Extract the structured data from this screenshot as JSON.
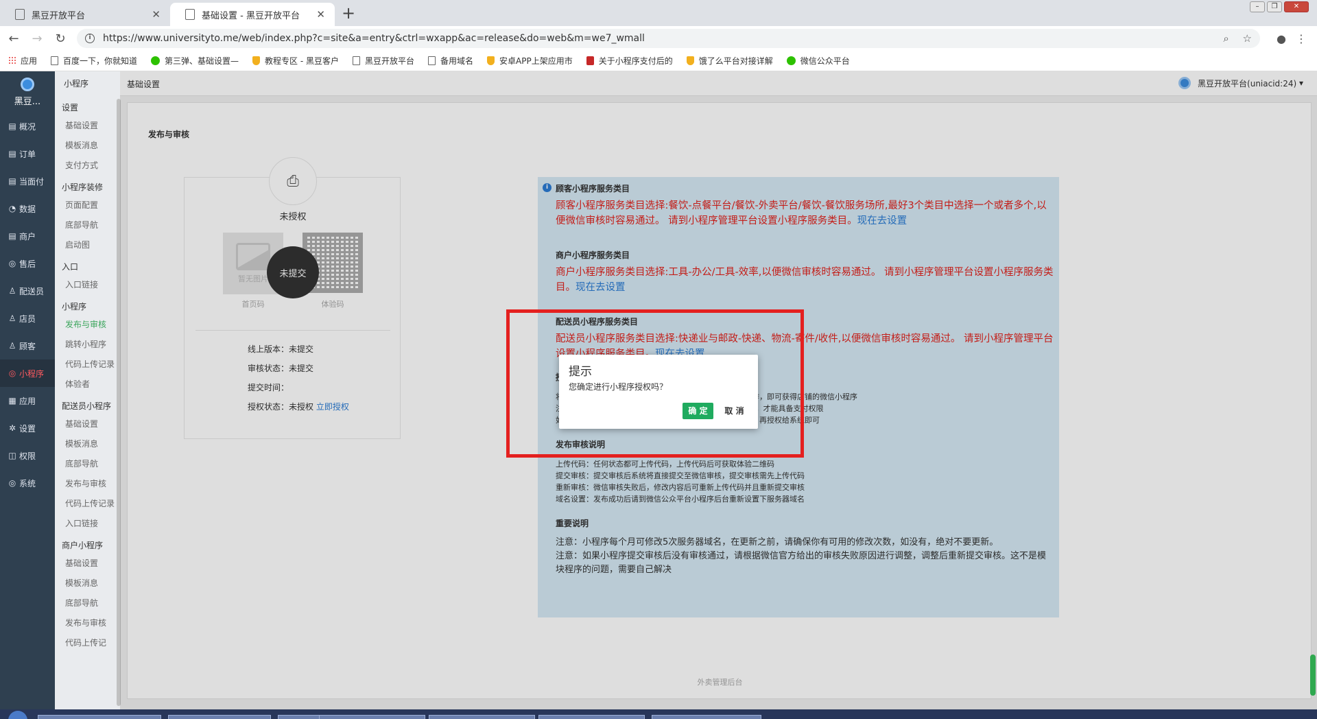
{
  "browser": {
    "tabs": [
      {
        "title": "黑豆开放平台",
        "active": false
      },
      {
        "title": "基础设置 - 黑豆开放平台",
        "active": true
      }
    ],
    "url": "https://www.universityto.me/web/index.php?c=site&a=entry&ctrl=wxapp&ac=release&do=web&m=we7_wmall",
    "bookmarks": [
      "应用",
      "百度一下，你就知道",
      "第三弹、基础设置—",
      "教程专区 - 黑豆客户",
      "黑豆开放平台",
      "备用域名",
      "安卓APP上架应用市",
      "关于小程序支付后的",
      "饿了么平台对接详解",
      "微信公众平台"
    ]
  },
  "app": {
    "logo_text": "黑豆...",
    "rail": [
      {
        "icon": "▤",
        "label": "概况"
      },
      {
        "icon": "▤",
        "label": "订单"
      },
      {
        "icon": "▤",
        "label": "当面付"
      },
      {
        "icon": "◔",
        "label": "数据"
      },
      {
        "icon": "▤",
        "label": "商户"
      },
      {
        "icon": "◎",
        "label": "售后"
      },
      {
        "icon": "♙",
        "label": "配送员"
      },
      {
        "icon": "♙",
        "label": "店员"
      },
      {
        "icon": "♙",
        "label": "顾客"
      },
      {
        "icon": "◎",
        "label": "小程序"
      },
      {
        "icon": "▦",
        "label": "应用"
      },
      {
        "icon": "✲",
        "label": "设置"
      },
      {
        "icon": "◫",
        "label": "权限"
      },
      {
        "icon": "◎",
        "label": "系统"
      }
    ],
    "sub_nav": {
      "header": "小程序",
      "g1": "设置",
      "g1_items": [
        "基础设置",
        "模板消息",
        "支付方式"
      ],
      "g2": "小程序装修",
      "g2_items": [
        "页面配置",
        "底部导航",
        "启动图"
      ],
      "g3": "入口",
      "g3_items": [
        "入口链接"
      ],
      "g4": "小程序",
      "g4_items": [
        "发布与审核",
        "跳转小程序",
        "代码上传记录",
        "体验者"
      ],
      "g5": "配送员小程序",
      "g5_items": [
        "基础设置",
        "模板消息",
        "底部导航",
        "发布与审核",
        "代码上传记录",
        "入口链接"
      ],
      "g6": "商户小程序",
      "g6_items": [
        "基础设置",
        "模板消息",
        "底部导航",
        "发布与审核",
        "代码上传记"
      ]
    },
    "breadcrumb": "基础设置",
    "account": "黑豆开放平台(uniacid:24)",
    "panel_title": "发布与审核",
    "card": {
      "auth_status": "未授权",
      "placeholder_text": "暂无图片",
      "home_code_label": "首页码",
      "exp_code_label": "体验码",
      "status_circle": "未提交",
      "online_version": "线上版本：未提交",
      "review_status": "审核状态：未提交",
      "submit_time": "提交时间：",
      "auth_status_label": "授权状态：未授权",
      "auth_link": "立即授权"
    },
    "notice": {
      "customer_title": "顾客小程序服务类目",
      "customer_text": "顾客小程序服务类目选择:餐饮-点餐平台/餐饮-外卖平台/餐饮-餐饮服务场所,最好3个类目中选择一个或者多个,以便微信审核时容易通过。 请到小程序管理平台设置小程序服务类目。",
      "customer_link": "现在去设置",
      "merchant_title": "商户小程序服务类目",
      "merchant_text": "商户小程序服务类目选择:工具-办公/工具-效率,以便微信审核时容易通过。 请到小程序管理平台设置小程序服务类目。",
      "merchant_link": "现在去设置",
      "deliver_title": "配送员小程序服务类目",
      "deliver_text": "配送员小程序服务类目选择:快递业与邮政-快递、物流-寄件/收件,以便微信审核时容易通过。 请到小程序管理平台设置小程序服务类目。",
      "deliver_link": "现在去设置",
      "auth_title": "授权说明",
      "auth_lines": [
        "将小程序授权给本平台，并提交到微信；你不需要做复杂操作，即可获得店铺的微信小程序",
        "注意：你的小程序的主体必须是「企业」，并开通了微信支付，才能具备支付权限",
        "如果你还没有注册微信小程序，点击此处注册；注册成功后，再授权给系统即可"
      ],
      "release_title": "发布审核说明",
      "release_lines": [
        "上传代码：任何状态都可上传代码，上传代码后可获取体验二维码",
        "提交审核：提交审核后系统将直接提交至微信审核，提交审核需先上传代码",
        "重新审核：微信审核失败后，修改内容后可重新上传代码并且重新提交审核",
        "域名设置：发布成功后请到微信公众平台小程序后台重新设置下服务器域名"
      ],
      "important_title": "重要说明",
      "important_lines": [
        "注意：小程序每个月可修改5次服务器域名，在更新之前，请确保你有可用的修改次数，如没有，绝对不要更新。",
        "注意：如果小程序提交审核后没有审核通过，请根据微信官方给出的审核失败原因进行调整，调整后重新提交审核。这不是模块程序的问题，需要自己解决"
      ]
    },
    "footer": "外卖管理后台"
  },
  "dialog": {
    "title": "提示",
    "message": "您确定进行小程序授权吗？",
    "ok": "确 定",
    "cancel": "取 消"
  },
  "colors": {
    "rail_bg": "#2f4050",
    "accent_green": "#1fab5f",
    "notice_bg": "#d6eaf5",
    "warning_red": "#e0221c",
    "link_blue": "#2a7bd4",
    "highlight_red": "#e4201f"
  }
}
